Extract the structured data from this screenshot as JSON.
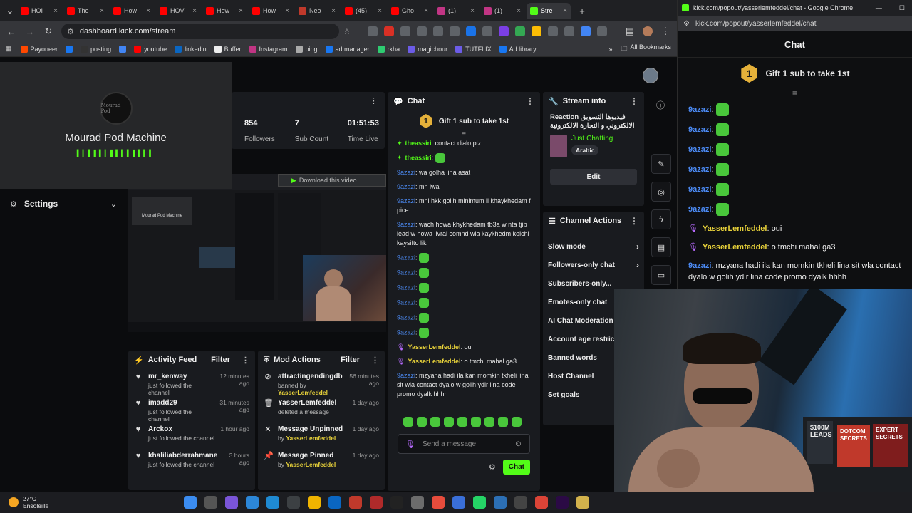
{
  "tabs": [
    {
      "label": "HOI",
      "color": "#ff0000"
    },
    {
      "label": "The",
      "color": "#ff0000"
    },
    {
      "label": "How",
      "color": "#ff0000"
    },
    {
      "label": "HOV",
      "color": "#ff0000"
    },
    {
      "label": "How",
      "color": "#ff0000"
    },
    {
      "label": "How",
      "color": "#ff0000"
    },
    {
      "label": "Neo",
      "color": "#c0392b"
    },
    {
      "label": "(45)",
      "color": "#ff0000"
    },
    {
      "label": "Gho",
      "color": "#ff0000"
    },
    {
      "label": "(1)",
      "color": "#c13584"
    },
    {
      "label": "(1)",
      "color": "#c13584"
    },
    {
      "label": "Stre",
      "color": "#53fc18",
      "active": true
    }
  ],
  "address": {
    "url": "dashboard.kick.com/stream"
  },
  "bookmarks": [
    {
      "label": "Payoneer",
      "color": "#ff4800"
    },
    {
      "label": "",
      "color": "#1877f2"
    },
    {
      "label": "posting",
      "color": "#333"
    },
    {
      "label": "",
      "color": "#4285f4"
    },
    {
      "label": "youtube",
      "color": "#ff0000"
    },
    {
      "label": "linkedin",
      "color": "#0a66c2"
    },
    {
      "label": "Buffer",
      "color": "#eee"
    },
    {
      "label": "Instagram",
      "color": "#c13584"
    },
    {
      "label": "ping",
      "color": "#aaa"
    },
    {
      "label": "ad manager",
      "color": "#1877f2"
    },
    {
      "label": "rkha",
      "color": "#2ecc71"
    },
    {
      "label": "magichour",
      "color": "#6c5ce7"
    },
    {
      "label": "TUTFLIX",
      "color": "#6c5ce7"
    },
    {
      "label": "Ad library",
      "color": "#1877f2"
    }
  ],
  "all_bookmarks": "All Bookmarks",
  "mini_player": {
    "name": "Mourad Pod Machine",
    "logo_text": "Mourad Pod"
  },
  "stats": [
    {
      "value": "854",
      "label": "Followers"
    },
    {
      "value": "7",
      "label": "Sub Counts"
    },
    {
      "value": "01:51:53",
      "label": "Time Live"
    }
  ],
  "download_label": "Download this video",
  "settings_label": "Settings",
  "chat": {
    "title": "Chat",
    "gift": "Gift 1 sub to take 1st",
    "gift_num": "1",
    "messages": [
      {
        "user": "theassiri",
        "text": "contact dialo plz",
        "kind": "green"
      },
      {
        "user": "theassiri",
        "text": "",
        "kind": "green",
        "emote": true
      },
      {
        "user": "9azazi",
        "text": "wa golha lina asat",
        "kind": "blue"
      },
      {
        "user": "9azazi",
        "text": "mn lwal",
        "kind": "blue"
      },
      {
        "user": "9azazi",
        "text": "mni hkk golih minimum li khaykhedam f pice",
        "kind": "blue"
      },
      {
        "user": "9azazi",
        "text": "wach howa khykhedam tb3a w nta tjib lead w howa livrai comnd wla kaykhedm kolchi kaysifto lik",
        "kind": "blue"
      },
      {
        "user": "9azazi",
        "text": "",
        "kind": "blue",
        "emote": true
      },
      {
        "user": "9azazi",
        "text": "",
        "kind": "blue",
        "emote": true
      },
      {
        "user": "9azazi",
        "text": "",
        "kind": "blue",
        "emote": true
      },
      {
        "user": "9azazi",
        "text": "",
        "kind": "blue",
        "emote": true
      },
      {
        "user": "9azazi",
        "text": "",
        "kind": "blue",
        "emote": true
      },
      {
        "user": "9azazi",
        "text": "",
        "kind": "blue",
        "emote": true
      },
      {
        "user": "YasserLemfeddel",
        "text": "oui",
        "kind": "yellow"
      },
      {
        "user": "YasserLemfeddel",
        "text": "o tmchi mahal ga3",
        "kind": "yellow"
      },
      {
        "user": "9azazi",
        "text": "mzyana hadi ila kan momkin tkheli lina sit wla contact dyalo w golih ydir lina code promo dyalk hhhh",
        "kind": "blue"
      }
    ],
    "placeholder": "Send a message",
    "send": "Chat"
  },
  "stream_info": {
    "title": "Stream info",
    "stream_title": "Reaction فيديوها التسويق الالكتروني و التجارة الالكترونية",
    "category": "Just Chatting",
    "tag": "Arabic",
    "edit": "Edit"
  },
  "channel_actions": {
    "title": "Channel Actions",
    "items": [
      {
        "label": "Slow mode",
        "chev": true
      },
      {
        "label": "Followers-only chat",
        "chev": true
      },
      {
        "label": "Subscribers-only...",
        "chev": false
      },
      {
        "label": "Emotes-only chat",
        "chev": false
      },
      {
        "label": "AI Chat Moderation",
        "chev": false
      },
      {
        "label": "Account age restric",
        "chev": false
      },
      {
        "label": "Banned words",
        "chev": false
      },
      {
        "label": "Host Channel",
        "chev": false
      },
      {
        "label": "Set goals",
        "chev": false
      }
    ]
  },
  "activity_feed": {
    "title": "Activity Feed",
    "filter": "Filter",
    "items": [
      {
        "name": "mr_kenway",
        "sub": "just followed the channel",
        "time": "12 minutes ago"
      },
      {
        "name": "imadd29",
        "sub": "just followed the channel",
        "time": "31 minutes ago"
      },
      {
        "name": "Arckox",
        "sub": "just followed the channel",
        "time": "1 hour ago"
      },
      {
        "name": "khaliliabderrahmane",
        "sub": "just followed the channel",
        "time": "3 hours ago"
      }
    ]
  },
  "mod_actions": {
    "title": "Mod Actions",
    "filter": "Filter",
    "items": [
      {
        "name": "attractingendingdb",
        "sub": "banned by",
        "by": "YasserLemfeddel",
        "time": "56 minutes ago",
        "icon": "⊘"
      },
      {
        "name": "YasserLemfeddel",
        "sub": "deleted a message",
        "by": "",
        "time": "1 day ago",
        "icon": "🗑"
      },
      {
        "name": "Message Unpinned",
        "sub": "by",
        "by": "YasserLemfeddel",
        "time": "1 day ago",
        "icon": "✕"
      },
      {
        "name": "Message Pinned",
        "sub": "by",
        "by": "YasserLemfeddel",
        "time": "1 day ago",
        "icon": "📌"
      }
    ]
  },
  "popout": {
    "window_title": "kick.com/popout/yasserlemfeddel/chat - Google Chrome",
    "url": "kick.com/popout/yasserlemfeddel/chat",
    "chat_title": "Chat",
    "gift": "Gift 1 sub to take 1st",
    "gift_num": "1",
    "lines": [
      {
        "user": "9azazi",
        "text": "",
        "emote": true,
        "kind": "blue"
      },
      {
        "user": "9azazi",
        "text": "",
        "emote": true,
        "kind": "blue"
      },
      {
        "user": "9azazi",
        "text": "",
        "emote": true,
        "kind": "blue"
      },
      {
        "user": "9azazi",
        "text": "",
        "emote": true,
        "kind": "blue"
      },
      {
        "user": "9azazi",
        "text": "",
        "emote": true,
        "kind": "blue"
      },
      {
        "user": "9azazi",
        "text": "",
        "emote": true,
        "kind": "blue"
      },
      {
        "user": "YasserLemfeddel",
        "text": "oui",
        "kind": "yellow"
      },
      {
        "user": "YasserLemfeddel",
        "text": "o tmchi mahal ga3",
        "kind": "yellow"
      },
      {
        "user": "9azazi",
        "text": "mzyana hadi ila kan momkin tkheli lina sit wla contact dyalo w golih ydir lina code promo dyalk hhhh",
        "kind": "blue"
      }
    ]
  },
  "webcam_text": [
    "$100M LEADS",
    "DOTCOM SECRETS",
    "EXPERT SECRETS"
  ],
  "weather": {
    "temp": "27°C",
    "desc": "Ensoleillé"
  },
  "colors": {
    "kick_green": "#53fc18",
    "panel": "#191b1f",
    "user_blue": "#4c8bf5",
    "user_yellow": "#e8d23a"
  }
}
